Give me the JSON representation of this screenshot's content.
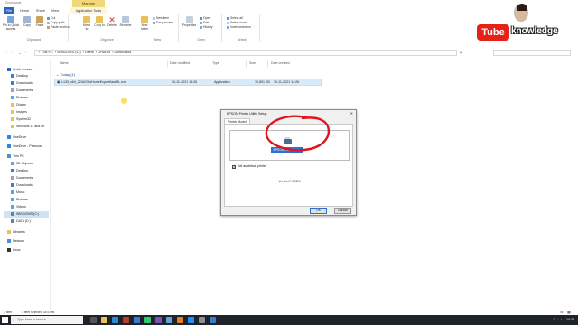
{
  "window": {
    "title": "Downloads",
    "manage_label": "Manage"
  },
  "tabs": {
    "file": "File",
    "home": "Home",
    "share": "Share",
    "view": "View",
    "app_tools": "Application Tools"
  },
  "ribbon": {
    "clipboard": {
      "pin": "Pin to Quick access",
      "copy": "Copy",
      "paste": "Paste",
      "cut": "Cut",
      "copy_path": "Copy path",
      "paste_shortcut": "Paste shortcut",
      "label": "Clipboard"
    },
    "organize": {
      "move_to": "Move to",
      "copy_to": "Copy to",
      "delete": "Delete",
      "rename": "Rename",
      "label": "Organize"
    },
    "new": {
      "new_folder": "New folder",
      "new_item": "New item",
      "easy_access": "Easy access",
      "label": "New"
    },
    "open": {
      "properties": "Properties",
      "open": "Open",
      "edit": "Edit",
      "history": "History",
      "label": "Open"
    },
    "select": {
      "select_all": "Select all",
      "select_none": "Select none",
      "invert": "Invert selection",
      "label": "Select"
    }
  },
  "address": {
    "crumbs": [
      "This PC",
      "WINDOWS (C:)",
      "Users",
      "DHARM",
      "Downloads"
    ],
    "search_placeholder": ""
  },
  "nav": {
    "items": [
      "Quick access",
      "Desktop",
      "Downloads",
      "Documents",
      "Pictures",
      "Dharm",
      "Images",
      "System32",
      "Windows 11 and let",
      "OneDrive",
      "OneDrive - Personal",
      "This PC",
      "3D Objects",
      "Desktop",
      "Documents",
      "Downloads",
      "Music",
      "Pictures",
      "Videos",
      "WINDOWS (C:)",
      "DATA (D:)",
      "Libraries",
      "Network",
      "Linux"
    ]
  },
  "columns": {
    "name": "Name",
    "date_modified": "Date modified",
    "type": "Type",
    "size": "Size",
    "date_created": "Date created"
  },
  "group": {
    "label": "Today (1)"
  },
  "file": {
    "name": "L130_x64_224USUsHomeExportAsiaML.exe",
    "date_modified": "10-11-2021 14:26",
    "type": "Application",
    "size": "70,891 KB",
    "date_created": "10-11-2021 14:26"
  },
  "status": {
    "items": "1 item",
    "selected": "1 item selected  34.6 MB"
  },
  "taskbar": {
    "search_placeholder": "Type here to search",
    "time": "14:28"
  },
  "dialog": {
    "title": "EPSON Printer Utility Setup",
    "tab": "Printer Model",
    "printer_label": "EPSON L130 Series",
    "default_checkbox": "Set as default printer",
    "version": "Version7.9.0EN",
    "ok": "OK",
    "cancel": "Cancel"
  },
  "branding": {
    "tube": "Tube",
    "word": "knowledge"
  },
  "colors": {
    "accent": "#2b65c2",
    "manage": "#f3d77b",
    "selection": "#d9ebf9",
    "annotation": "#e0141b",
    "taskbar": "#1e2329"
  }
}
